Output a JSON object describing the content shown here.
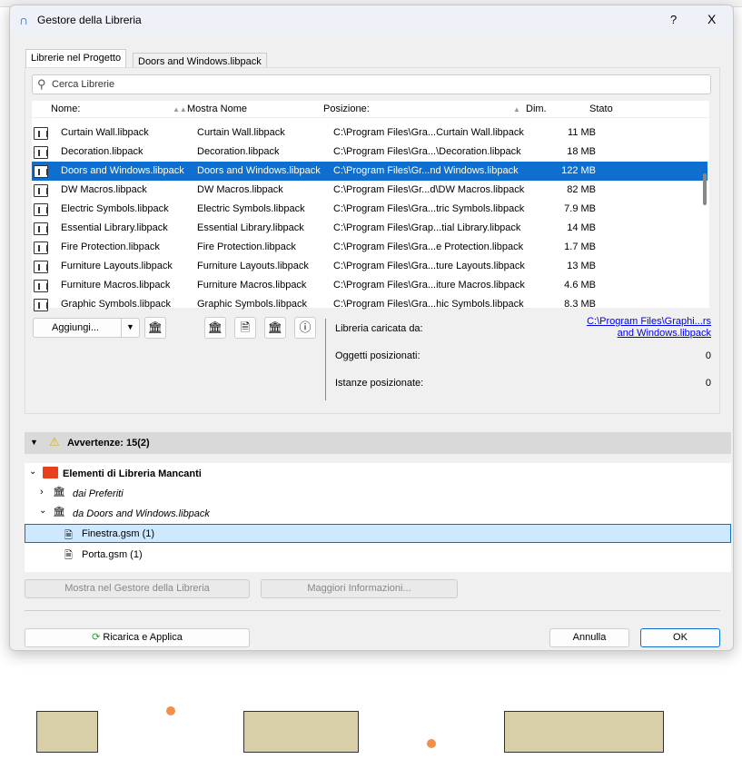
{
  "window": {
    "title": "Gestore della Libreria",
    "help": "?",
    "close": "X"
  },
  "tabs": [
    {
      "label": "Librerie nel Progetto",
      "active": true
    },
    {
      "label": "Doors and Windows.libpack",
      "active": false
    }
  ],
  "search": {
    "placeholder": "Cerca Librerie"
  },
  "columns": [
    "Nome:",
    "Mostra Nome",
    "Posizione:",
    "Dim.",
    "Stato"
  ],
  "rows": [
    {
      "name": "Curtain Wall.libpack",
      "display": "Curtain Wall.libpack",
      "path": "C:\\Program Files\\Gra...Curtain Wall.libpack",
      "size": "11 MB",
      "status": ""
    },
    {
      "name": "Decoration.libpack",
      "display": "Decoration.libpack",
      "path": "C:\\Program Files\\Gra...\\Decoration.libpack",
      "size": "18 MB",
      "status": ""
    },
    {
      "name": "Doors and Windows.libpack",
      "display": "Doors and Windows.libpack",
      "path": "C:\\Program Files\\Gr...nd Windows.libpack",
      "size": "122 MB",
      "status": "",
      "selected": true
    },
    {
      "name": "DW Macros.libpack",
      "display": "DW Macros.libpack",
      "path": "C:\\Program Files\\Gr...d\\DW Macros.libpack",
      "size": "82 MB",
      "status": ""
    },
    {
      "name": "Electric Symbols.libpack",
      "display": "Electric Symbols.libpack",
      "path": "C:\\Program Files\\Gra...tric Symbols.libpack",
      "size": "7.9 MB",
      "status": ""
    },
    {
      "name": "Essential Library.libpack",
      "display": "Essential Library.libpack",
      "path": "C:\\Program Files\\Grap...tial Library.libpack",
      "size": "14 MB",
      "status": ""
    },
    {
      "name": "Fire Protection.libpack",
      "display": "Fire Protection.libpack",
      "path": "C:\\Program Files\\Gra...e Protection.libpack",
      "size": "1.7 MB",
      "status": ""
    },
    {
      "name": "Furniture Layouts.libpack",
      "display": "Furniture Layouts.libpack",
      "path": "C:\\Program Files\\Gra...ture Layouts.libpack",
      "size": "13 MB",
      "status": ""
    },
    {
      "name": "Furniture Macros.libpack",
      "display": "Furniture Macros.libpack",
      "path": "C:\\Program Files\\Gra...iture Macros.libpack",
      "size": "4.6 MB",
      "status": ""
    },
    {
      "name": "Graphic Symbols.libpack",
      "display": "Graphic Symbols.libpack",
      "path": "C:\\Program Files\\Gra...hic Symbols.libpack",
      "size": "8.3 MB",
      "status": ""
    }
  ],
  "actions": {
    "add": "Aggiungi..."
  },
  "details": {
    "loaded_from_label": "Libreria caricata da:",
    "loaded_from_line1": "C:\\Program Files\\Graphi...rs",
    "loaded_from_line2": "and Windows.libpack",
    "placed_objects_label": "Oggetti posizionati:",
    "placed_objects": "0",
    "placed_instances_label": "Istanze posizionate:",
    "placed_instances": "0"
  },
  "warnings": {
    "label": "Avvertenze: 15(2)"
  },
  "tree": {
    "root": "Elementi di Libreria Mancanti",
    "favorites": "dai Preferiti",
    "from_lib": "da Doors and Windows.libpack",
    "items": [
      "Finestra.gsm (1)",
      "Porta.gsm (1)"
    ]
  },
  "buttons": {
    "show_in_manager": "Mostra nel Gestore della Libreria",
    "more_info": "Maggiori Informazioni...",
    "reload": "Ricarica e Applica",
    "cancel": "Annulla",
    "ok": "OK"
  },
  "colors": {
    "selection": "#0e6fd0",
    "link": "#0000ee",
    "folder": "#e8401c"
  }
}
